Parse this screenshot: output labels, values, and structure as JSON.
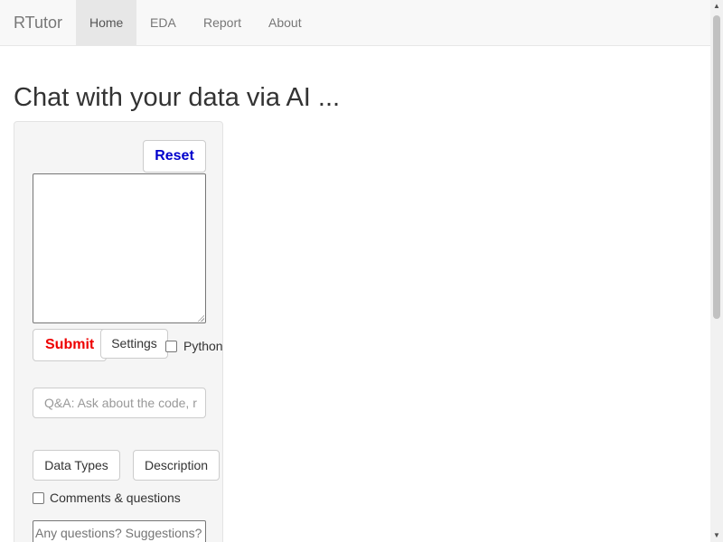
{
  "navbar": {
    "brand": "RTutor",
    "items": [
      {
        "label": "Home",
        "active": true
      },
      {
        "label": "EDA",
        "active": false
      },
      {
        "label": "Report",
        "active": false
      },
      {
        "label": "About",
        "active": false
      }
    ]
  },
  "main": {
    "title": "Chat with your data via AI ..."
  },
  "panel": {
    "reset_label": "Reset",
    "prompt_value": "",
    "submit_label": "Submit",
    "settings_label": "Settings",
    "python_label": "Python",
    "python_checked": false,
    "qa_placeholder": "Q&A: Ask about the code, r",
    "data_types_label": "Data Types",
    "description_label": "Description",
    "comments_label": "Comments & questions",
    "comments_checked": false,
    "feedback_placeholder": "Any questions? Suggestions?"
  },
  "colors": {
    "reset_text": "#0000cc",
    "submit_text": "#ee0000",
    "navbar_bg": "#f8f8f8",
    "active_tab_bg": "#e7e7e7",
    "panel_bg": "#f5f5f5"
  },
  "icons": {
    "scroll_up": "triangle-up-icon",
    "scroll_down": "triangle-down-icon"
  }
}
